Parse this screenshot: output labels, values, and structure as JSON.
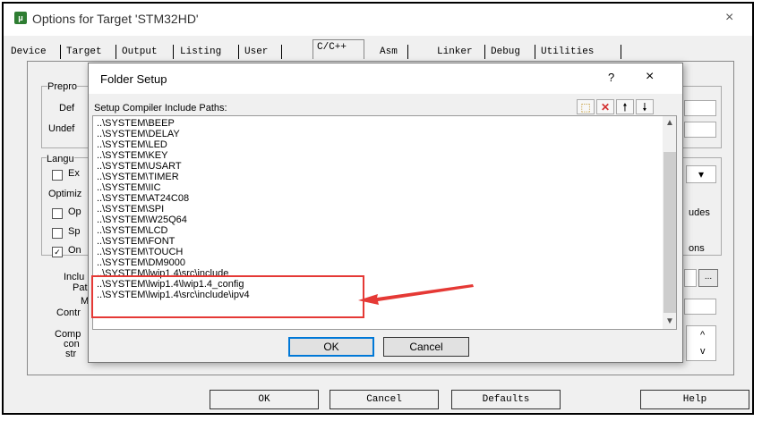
{
  "window": {
    "title": "Options for Target 'STM32HD'",
    "close_glyph": "×"
  },
  "tabs": [
    {
      "label": "Device"
    },
    {
      "label": "Target"
    },
    {
      "label": "Output"
    },
    {
      "label": "Listing"
    },
    {
      "label": "User"
    },
    {
      "label": "C/C++",
      "selected": true
    },
    {
      "label": "Asm"
    },
    {
      "label": "Linker"
    },
    {
      "label": "Debug"
    },
    {
      "label": "Utilities"
    }
  ],
  "background_panel": {
    "labels": [
      "Prepro",
      "Def",
      "Undef",
      "Langu",
      "Ex",
      "Optimiz",
      "Op",
      "Sp",
      "On",
      "udes",
      "ons",
      "Inclu",
      "Pat",
      "M",
      "Contr",
      "Comp",
      "con",
      "str"
    ],
    "dropdown_glyph": "▾",
    "browse_label": "...",
    "scroll_up": "^",
    "scroll_down": "v",
    "checked_glyph": "✓"
  },
  "footer_buttons": {
    "ok": "OK",
    "cancel": "Cancel",
    "defaults": "Defaults",
    "help": "Help"
  },
  "dialog": {
    "title": "Folder Setup",
    "help_glyph": "?",
    "close_glyph": "×",
    "list_label": "Setup Compiler Include Paths:",
    "toolbar": {
      "new_glyph": "⬚",
      "delete_glyph": "✕",
      "up_glyph": "🠕",
      "down_glyph": "🠗"
    },
    "paths": [
      "..\\SYSTEM\\BEEP",
      "..\\SYSTEM\\DELAY",
      "..\\SYSTEM\\LED",
      "..\\SYSTEM\\KEY",
      "..\\SYSTEM\\USART",
      "..\\SYSTEM\\TIMER",
      "..\\SYSTEM\\IIC",
      "..\\SYSTEM\\AT24C08",
      "..\\SYSTEM\\SPI",
      "..\\SYSTEM\\W25Q64",
      "..\\SYSTEM\\LCD",
      "..\\SYSTEM\\FONT",
      "..\\SYSTEM\\TOUCH",
      "..\\SYSTEM\\DM9000",
      "..\\SYSTEM\\lwip1.4\\src\\include",
      "..\\SYSTEM\\lwip1.4\\lwip1.4_config",
      "..\\SYSTEM\\lwip1.4\\src\\include\\ipv4"
    ],
    "ok_label": "OK",
    "cancel_label": "Cancel"
  },
  "colors": {
    "highlight": "#e53935",
    "focus": "#0078d7"
  }
}
